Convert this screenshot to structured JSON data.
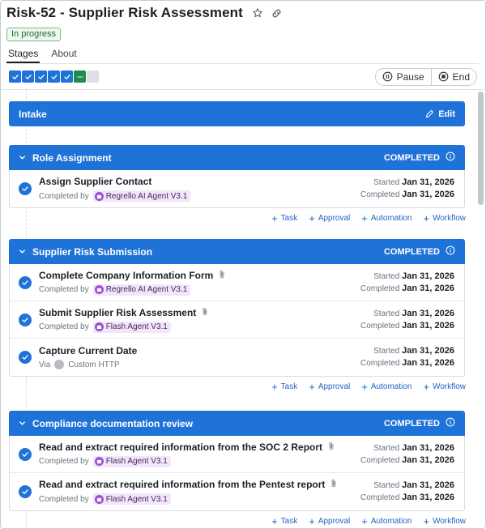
{
  "header": {
    "title": "Risk-52 - Supplier Risk Assessment",
    "status": "In progress",
    "tabs": [
      "Stages",
      "About"
    ]
  },
  "controls": {
    "pause": "Pause",
    "end": "End"
  },
  "stages_progress": {
    "completed": 5,
    "current": 1,
    "remaining": 1
  },
  "intake": {
    "name": "Intake",
    "edit": "Edit"
  },
  "action_labels": {
    "task": "Task",
    "approval": "Approval",
    "automation": "Automation",
    "workflow": "Workflow"
  },
  "stages": [
    {
      "name": "Role Assignment",
      "status": "COMPLETED",
      "tasks": [
        {
          "name": "Assign Supplier Contact",
          "via_label": "Completed by",
          "agent": "Regrello AI Agent V3.1",
          "started_label": "Started",
          "started": "Jan 31, 2026",
          "completed_label": "Completed",
          "completed": "Jan 31, 2026"
        }
      ]
    },
    {
      "name": "Supplier Risk Submission",
      "status": "COMPLETED",
      "tasks": [
        {
          "name": "Complete Company Information Form",
          "via_label": "Completed by",
          "agent": "Regrello AI Agent V3.1",
          "started_label": "Started",
          "started": "Jan 31, 2026",
          "completed_label": "Completed",
          "completed": "Jan 31, 2026"
        },
        {
          "name": "Submit Supplier Risk Assessment",
          "via_label": "Completed by",
          "agent": "Flash Agent V3.1",
          "started_label": "Started",
          "started": "Jan 31, 2026",
          "completed_label": "Completed",
          "completed": "Jan 31, 2026"
        },
        {
          "name": "Capture Current Date",
          "via_label": "Via",
          "agent": "Custom HTTP",
          "started_label": "Started",
          "started": "Jan 31, 2026",
          "completed_label": "Completed",
          "completed": "Jan 31, 2026"
        }
      ]
    },
    {
      "name": "Compliance documentation review",
      "status": "COMPLETED",
      "tasks": [
        {
          "name": "Read and extract required information from the SOC 2 Report",
          "via_label": "Completed by",
          "agent": "Flash Agent V3.1",
          "started_label": "Started",
          "started": "Jan 31, 2026",
          "completed_label": "Completed",
          "completed": "Jan 31, 2026"
        },
        {
          "name": "Read and extract required information from the Pentest report",
          "via_label": "Completed by",
          "agent": "Flash Agent V3.1",
          "started_label": "Started",
          "started": "Jan 31, 2026",
          "completed_label": "Completed",
          "completed": "Jan 31, 2026"
        }
      ]
    }
  ],
  "colors": {
    "accent": "#1f73d8",
    "current_stage": "#1d8a4e",
    "agent_bg": "#f3e6fa",
    "status_green": "#1e6b33"
  }
}
